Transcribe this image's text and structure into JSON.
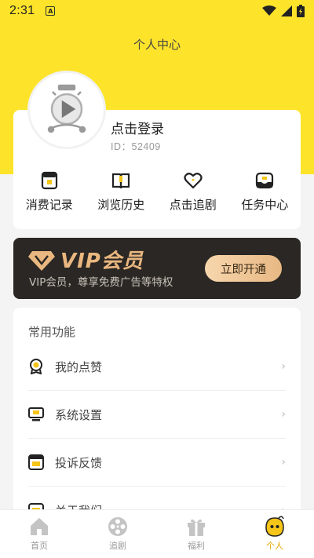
{
  "status_bar": {
    "time": "2:31",
    "badge": "A"
  },
  "header": {
    "title": "个人中心"
  },
  "profile": {
    "login_text": "点击登录",
    "user_id": "ID：52409"
  },
  "quick_actions": [
    {
      "label": "消费记录",
      "icon": "receipt-icon"
    },
    {
      "label": "浏览历史",
      "icon": "book-icon"
    },
    {
      "label": "点击追剧",
      "icon": "heart-icon"
    },
    {
      "label": "任务中心",
      "icon": "inbox-icon"
    }
  ],
  "vip": {
    "title": "VIP会员",
    "subtitle": "VIP会员，尊享免费广告等特权",
    "button": "立即开通",
    "colors": {
      "background": "#2a2724",
      "gold": "#e9b77f"
    }
  },
  "functions": {
    "header": "常用功能",
    "items": [
      {
        "label": "我的点赞",
        "icon": "medal-icon"
      },
      {
        "label": "系统设置",
        "icon": "monitor-icon"
      },
      {
        "label": "投诉反馈",
        "icon": "feedback-icon"
      },
      {
        "label": "关于我们",
        "icon": "info-icon"
      }
    ]
  },
  "tabbar": {
    "items": [
      {
        "label": "首页",
        "icon": "home-icon"
      },
      {
        "label": "追剧",
        "icon": "film-reel-icon"
      },
      {
        "label": "福利",
        "icon": "gift-icon"
      },
      {
        "label": "个人",
        "icon": "profile-face-icon"
      }
    ],
    "active": 3
  },
  "theme": {
    "accent": "#fde42a",
    "active_tab": "#e5a800"
  }
}
